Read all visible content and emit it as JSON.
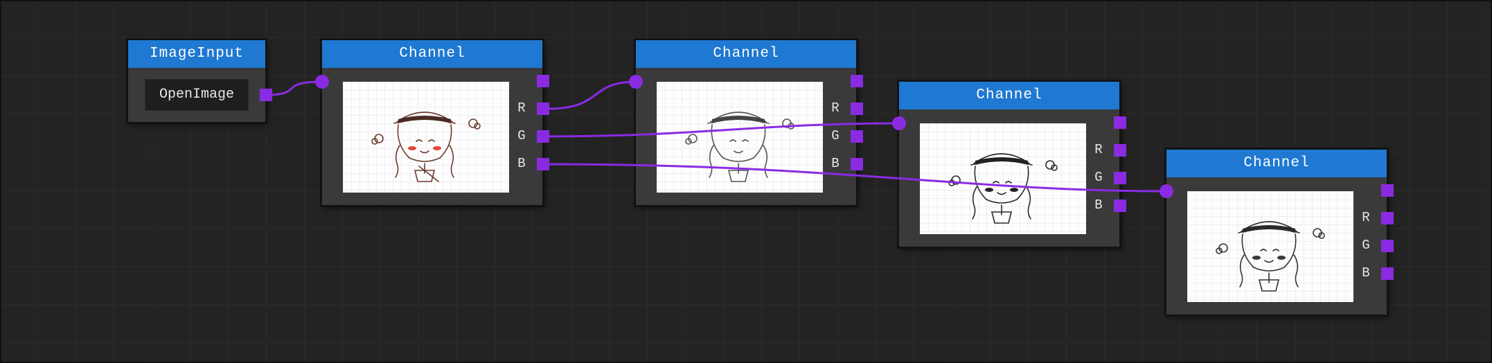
{
  "colors": {
    "background": "#232323",
    "node_body": "#3a3a3a",
    "header": "#1f78d1",
    "port": "#8a2be2",
    "wire": "#8a2be2"
  },
  "nodes": {
    "image_input": {
      "title": "ImageInput",
      "button_label": "OpenImage"
    },
    "channel_1": {
      "title": "Channel",
      "ports": [
        "R",
        "G",
        "B"
      ],
      "preview_tint": "color"
    },
    "channel_2": {
      "title": "Channel",
      "ports": [
        "R",
        "G",
        "B"
      ],
      "preview_tint": "grayscale"
    },
    "channel_3": {
      "title": "Channel",
      "ports": [
        "R",
        "G",
        "B"
      ],
      "preview_tint": "grayscale"
    },
    "channel_4": {
      "title": "Channel",
      "ports": [
        "R",
        "G",
        "B"
      ],
      "preview_tint": "grayscale"
    }
  },
  "connections": [
    {
      "from": "image_input.out",
      "to": "channel_1.in"
    },
    {
      "from": "channel_1.R",
      "to": "channel_2.in"
    },
    {
      "from": "channel_1.G",
      "to": "channel_3.in"
    },
    {
      "from": "channel_1.B",
      "to": "channel_4.in"
    }
  ]
}
